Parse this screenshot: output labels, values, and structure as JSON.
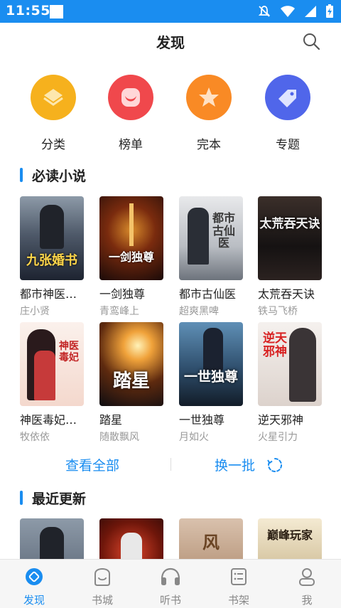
{
  "status_bar": {
    "time": "11:55"
  },
  "header": {
    "title": "发现"
  },
  "categories": [
    {
      "label": "分类",
      "icon": "layers-icon",
      "color": "#f6b11d"
    },
    {
      "label": "榜单",
      "icon": "moon-icon",
      "color": "#f0484c"
    },
    {
      "label": "完本",
      "icon": "star-icon",
      "color": "#f98a25"
    },
    {
      "label": "专题",
      "icon": "tag-icon",
      "color": "#5066ea"
    }
  ],
  "must_read": {
    "title": "必读小说",
    "books": [
      {
        "title": "都市神医开局九张婚书",
        "author": "庄小贤",
        "cover_text": "九张婚书"
      },
      {
        "title": "一剑独尊",
        "author": "青鸾峰上",
        "cover_text": "一剑独尊"
      },
      {
        "title": "都市古仙医",
        "author": "超爽黑啤",
        "cover_text": "都市古仙医"
      },
      {
        "title": "太荒吞天诀",
        "author": "铁马飞桥",
        "cover_text": "太荒吞天诀"
      },
      {
        "title": "神医毒妃倾天下",
        "author": "牧依依",
        "cover_text": "神医毒妃"
      },
      {
        "title": "踏星",
        "author": "随散飘风",
        "cover_text": "踏星"
      },
      {
        "title": "一世独尊",
        "author": "月如火",
        "cover_text": "一世独尊"
      },
      {
        "title": "逆天邪神",
        "author": "火星引力",
        "cover_text": "逆天邪神"
      }
    ],
    "view_all": "查看全部",
    "refresh": "换一批"
  },
  "recent": {
    "title": "最近更新",
    "covers": [
      "",
      "",
      "风",
      "巅峰玩家"
    ]
  },
  "bottom_nav": [
    {
      "label": "发现",
      "icon": "compass-icon",
      "active": true
    },
    {
      "label": "书城",
      "icon": "bookstore-icon",
      "active": false
    },
    {
      "label": "听书",
      "icon": "headphones-icon",
      "active": false
    },
    {
      "label": "书架",
      "icon": "bookshelf-icon",
      "active": false
    },
    {
      "label": "我",
      "icon": "profile-icon",
      "active": false
    }
  ]
}
